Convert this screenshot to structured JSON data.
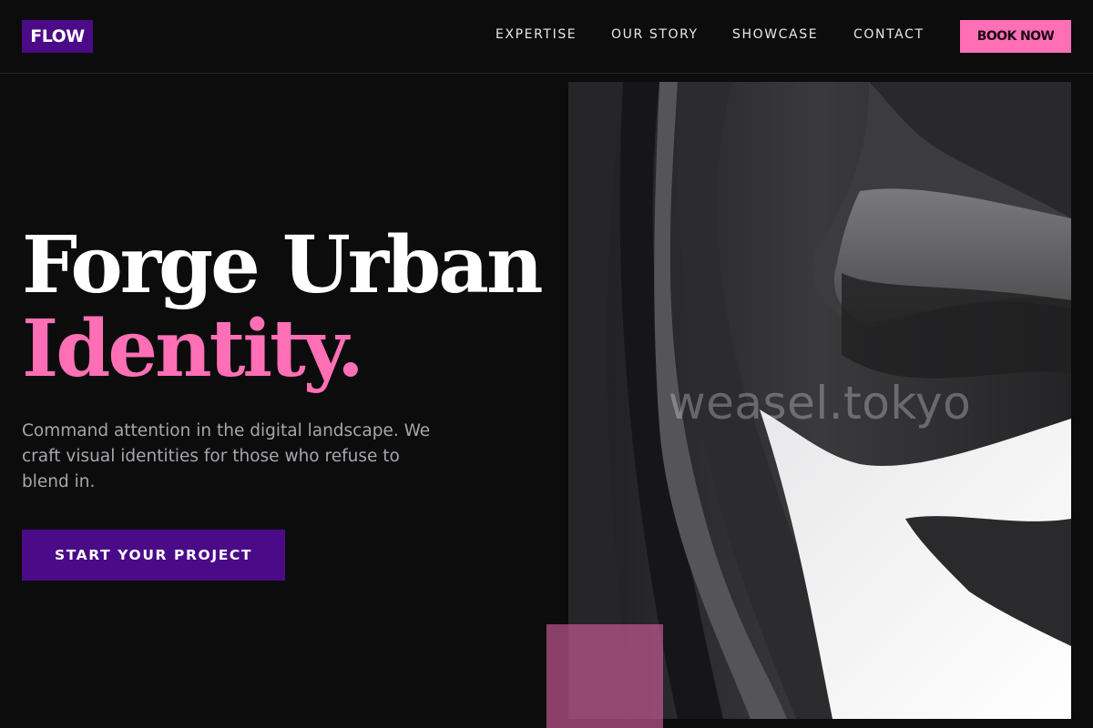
{
  "header": {
    "logo": "FLOW",
    "nav": [
      "EXPERTISE",
      "OUR STORY",
      "SHOWCASE",
      "CONTACT"
    ],
    "book_label": "BOOK NOW"
  },
  "hero": {
    "headline_line1": "Forge Urban",
    "headline_line2": "Identity.",
    "subtext": "Command attention in the digital landscape. We craft visual identities for those who refuse to blend in.",
    "cta_label": "START YOUR PROJECT"
  },
  "image": {
    "watermark": "weasel.tokyo"
  },
  "colors": {
    "background": "#0c0c0d",
    "brand_purple": "#4b0a87",
    "accent_pink": "#ff6fb5"
  }
}
